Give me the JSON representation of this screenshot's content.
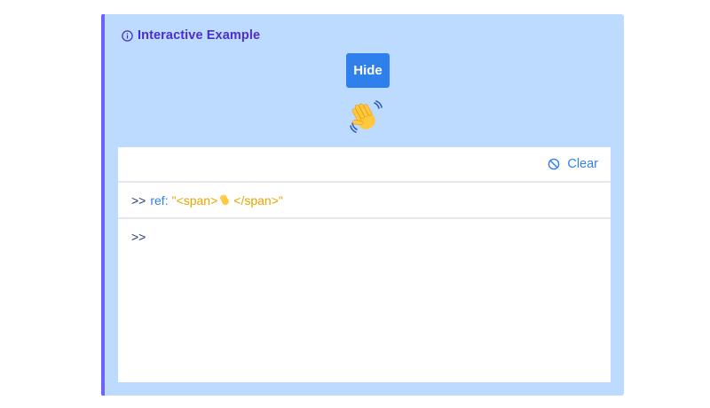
{
  "example": {
    "title": "Interactive Example",
    "hide_label": "Hide",
    "accent_color": "#6c63ff",
    "background_color": "#bddaff",
    "emoji_icon": "waving-hand-icon"
  },
  "console": {
    "clear_label": "Clear",
    "clear_icon": "no-entry-icon",
    "log": {
      "prompt": ">>",
      "key": "ref:",
      "value_before": "\"<span>",
      "value_icon": "waving-hand-icon",
      "value_after": "</span>\""
    },
    "input_prompt": ">>"
  }
}
